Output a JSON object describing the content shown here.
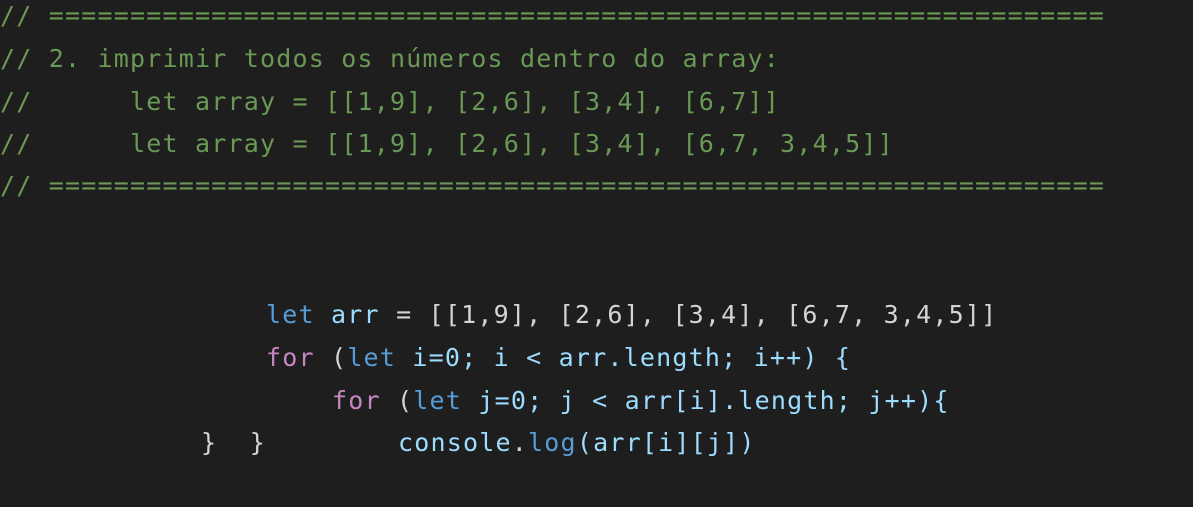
{
  "theme": {
    "background": "#1e1e1e",
    "comment": "#6a9955",
    "keyword_declaration": "#569cd6",
    "keyword_control": "#c586c0",
    "identifier": "#9cdcfe",
    "punctuation": "#d4d4d4"
  },
  "comments": [
    "// =================================================================",
    "// 2. imprimir todos os números dentro do array:",
    "//      let array = [[1,9], [2,6], [3,4], [6,7]]",
    "//      let array = [[1,9], [2,6], [3,4], [6,7, 3,4,5]]",
    "// ================================================================="
  ],
  "code": {
    "line1": {
      "kw": "let",
      "var": "arr",
      "op": " = ",
      "value": "[[1,9], [2,6], [3,4], [6,7, 3,4,5]]"
    },
    "line2": {
      "kw": "for",
      "open": " (",
      "let_kw": "let",
      "init": " i=0; i < arr.length; i++) {"
    },
    "line3": {
      "kw": "for",
      "open": " (",
      "let_kw": "let",
      "init": " j=0; j < arr[i].length; j++){"
    },
    "line4": {
      "obj": "console",
      "dot": ".",
      "method": "log",
      "args": "(arr[i][j])"
    },
    "line5": {
      "close": "}  }"
    }
  }
}
